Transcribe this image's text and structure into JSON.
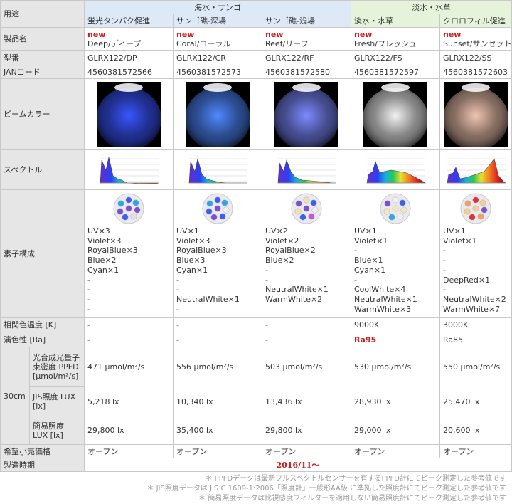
{
  "header": {
    "purpose_label": "用途",
    "group_sea": "海水・サンゴ",
    "group_fresh": "淡水・水草"
  },
  "labels": {
    "product_name": "製品名",
    "model": "型番",
    "jan": "JANコード",
    "beam": "ビームカラー",
    "spectrum": "スペクトル",
    "elements": "素子構成",
    "cct": "相関色温度 [K]",
    "cri": "演色性 [Ra]",
    "distance": "30cm",
    "ppfd": "光合成光量子束密度 PPFD [μmol/m²/s]",
    "jis": "JIS照度 LUX [lx]",
    "simple": "簡易照度 LUX [lx]",
    "price": "希望小売価格",
    "period": "製造時期"
  },
  "products": [
    {
      "purpose": "蛍光タンパク促進",
      "new": "new",
      "name": "Deep/ディープ",
      "model": "GLRX122/DP",
      "jan": "4560381572566",
      "beam_color": "#3a55ff",
      "spectrum": "deep",
      "dot_colors": [
        "#7b4fd0",
        "#3c5ff0",
        "#2aa8e0",
        "#7b4fd0",
        "#e0e0e8",
        "#3c5ff0",
        "#7b4fd0",
        "#2aa8e0",
        "#3c5ff0"
      ],
      "elements": [
        "UV×3",
        "Violet×3",
        "RoyalBlue×3",
        "Blue×2",
        "Cyan×1",
        "-",
        "-",
        "-",
        "-"
      ],
      "cct": "-",
      "cri": "-",
      "ppfd": "471 μmol/m²/s",
      "jis": "5,218 lx",
      "simple": "29,800 lx",
      "price": "オープン"
    },
    {
      "purpose": "サンゴ礁-深場",
      "new": "new",
      "name": "Coral/コーラル",
      "model": "GLRX122/CR",
      "jan": "4560381572573",
      "beam_color": "#4f88ff",
      "spectrum": "coral",
      "dot_colors": [
        "#7b4fd0",
        "#3c5ff0",
        "#2aa8e0",
        "#f0f0f0",
        "#3c5ff0",
        "#7b4fd0",
        "#3c5ff0",
        "#2aa8e0",
        "#7b4fd0"
      ],
      "elements": [
        "UV×1",
        "Violet×3",
        "RoyalBlue×3",
        "Blue×3",
        "Cyan×1",
        "-",
        "-",
        "NeutralWhite×1",
        "-"
      ],
      "cct": "-",
      "cri": "-",
      "ppfd": "556 μmol/m²/s",
      "jis": "10,340 lx",
      "simple": "35,400 lx",
      "price": "オープン"
    },
    {
      "purpose": "サンゴ礁-浅場",
      "new": "new",
      "name": "Reef/リーフ",
      "model": "GLRX122/RF",
      "jan": "4560381572580",
      "beam_color": "#7d8aff",
      "spectrum": "reef",
      "dot_colors": [
        "#7b4fd0",
        "#f2e0b0",
        "#3c5ff0",
        "#f0f0f0",
        "#c05ad0",
        "#3c5ff0",
        "#f2e0b0",
        "#7b4fd0",
        "#3c5ff0"
      ],
      "elements": [
        "UV×2",
        "Violet×2",
        "RoyalBlue×2",
        "Blue×2",
        "-",
        "-",
        "NeutralWhite×1",
        "WarmWhite×2",
        ""
      ],
      "cct": "-",
      "cri": "-",
      "ppfd": "503 μmol/m²/s",
      "jis": "13,436 lx",
      "simple": "29,800 lx",
      "price": "オープン"
    },
    {
      "purpose": "淡水・水草",
      "new": "new",
      "name": "Fresh/フレッシュ",
      "model": "GLRX122/FS",
      "jan": "4560381572597",
      "beam_color": "#f2f2f2",
      "spectrum": "fresh",
      "dot_colors": [
        "#f4e4c0",
        "#f0f0f0",
        "#3c5ff0",
        "#f4e4c0",
        "#f0f0f0",
        "#2aa8e0",
        "#f4e4c0",
        "#7b4fd0",
        "#f0f0f0"
      ],
      "elements": [
        "UV×1",
        "Violet×1",
        "-",
        "Blue×1",
        "Cyan×1",
        "-",
        "CoolWhite×4",
        "NeutralWhite×1",
        "WarmWhite×3"
      ],
      "cct": "9000K",
      "cri": "Ra95",
      "ppfd": "530 μmol/m²/s",
      "jis": "28,930 lx",
      "simple": "29,000 lx",
      "price": "オープン"
    },
    {
      "purpose": "クロロフィル促進",
      "new": "new",
      "name": "Sunset/サンセット",
      "model": "GLRX122/SS",
      "jan": "4560381572603",
      "beam_color": "#f0c4b0",
      "spectrum": "sunset",
      "dot_colors": [
        "#f4d090",
        "#e03040",
        "#f4d090",
        "#7b4fd0",
        "#f0a060",
        "#e03040",
        "#f4d090",
        "#f0a060",
        "#f4d090"
      ],
      "elements": [
        "UV×1",
        "Violet×1",
        "-",
        "-",
        "-",
        "DeepRed×1",
        "-",
        "NeutralWhite×2",
        "WarmWhite×7"
      ],
      "cct": "3000K",
      "cri": "Ra85",
      "ppfd": "550 μmol/m²/s",
      "jis": "25,470 lx",
      "simple": "20,600 lx",
      "price": "オープン"
    }
  ],
  "period_value": "2016/11〜",
  "notes": [
    "＊ PPFDデータは最新フルスペクトルセンサーを有するPPFD計にてピーク測定した参考値です",
    "＊ JIS照度データは JIS C 1609-1:2006「照度計」一般形AA級 に準拠した照度計にてピーク測定した参考値です",
    "＊ 簡易照度データは比視感度フィルターを適用しない簡易照度計にてピーク測定した参考値です"
  ]
}
